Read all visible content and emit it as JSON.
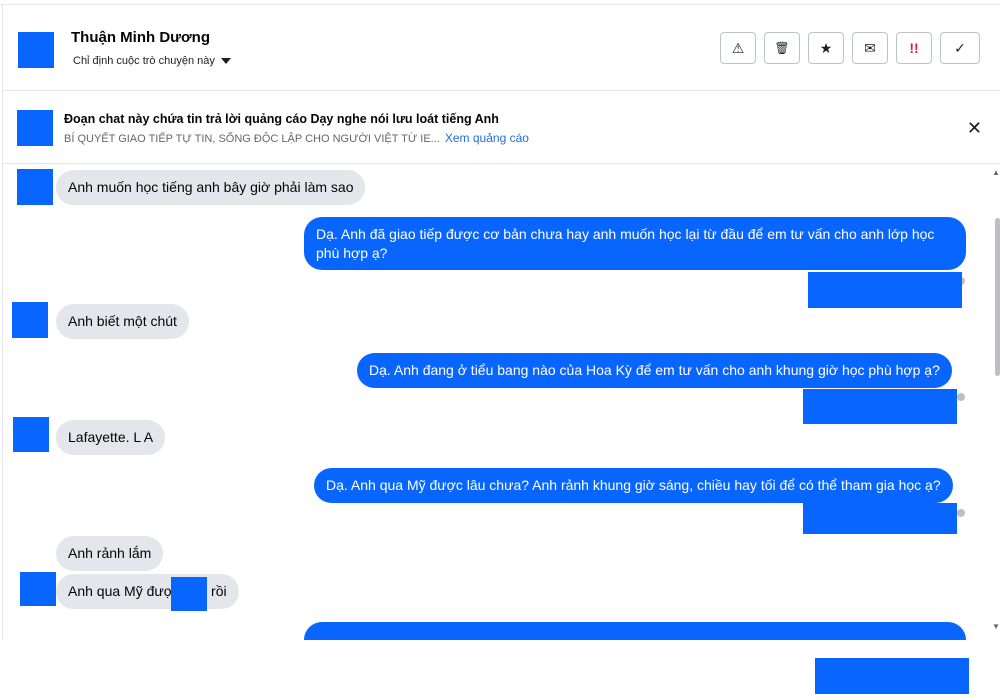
{
  "header": {
    "contact_name": "Thuận Minh Dương",
    "assign_label": "Chỉ định cuộc trò chuyện này",
    "actions": [
      {
        "name": "warning-icon",
        "glyph": "⚠"
      },
      {
        "name": "trash-icon",
        "glyph": "🗑"
      },
      {
        "name": "star-icon",
        "glyph": "★"
      },
      {
        "name": "mail-icon",
        "glyph": "✉"
      },
      {
        "name": "spam-icon",
        "glyph": "!!"
      },
      {
        "name": "check-icon",
        "glyph": "✓"
      }
    ]
  },
  "ad": {
    "title": "Đoạn chat này chứa tin trả lời quảng cáo Dạy nghe nói lưu loát tiếng Anh",
    "subtitle": "BÍ QUYẾT GIAO TIẾP TỰ TIN, SỐNG ĐỘC LẬP CHO NGƯỜI VIỆT TỪ IE...",
    "link": "Xem quảng cáo",
    "close": "✕"
  },
  "messages": [
    {
      "dir": "in",
      "text": "Anh muốn học tiếng anh bây giờ phải làm sao"
    },
    {
      "dir": "out",
      "text": "Dạ. Anh đã giao tiếp được cơ bản chưa hay anh muốn học lại từ đầu để em tư vấn cho anh lớp học phù hợp ạ?"
    },
    {
      "dir": "in",
      "text": "Anh biết  một chút"
    },
    {
      "dir": "out",
      "text": "Dạ. Anh đang ở tiểu bang nào của Hoa Kỳ để em tư vấn cho anh khung giờ học phù hợp ạ?"
    },
    {
      "dir": "in",
      "text": "Lafayette. L  A"
    },
    {
      "dir": "out",
      "text": "Dạ. Anh qua Mỹ được lâu chưa? Anh rảnh khung giờ sáng, chiều hay tối để có thể tham gia học ạ?"
    },
    {
      "dir": "in",
      "text": "Anh rảnh lắm"
    },
    {
      "dir": "in",
      "text": "Anh qua Mỹ được        rồi"
    }
  ],
  "scrollbar": {
    "up": "▲",
    "down": "▼"
  },
  "colors": {
    "accent": "#0866ff",
    "incoming": "#e4e6eb",
    "border": "#e4e6eb"
  }
}
